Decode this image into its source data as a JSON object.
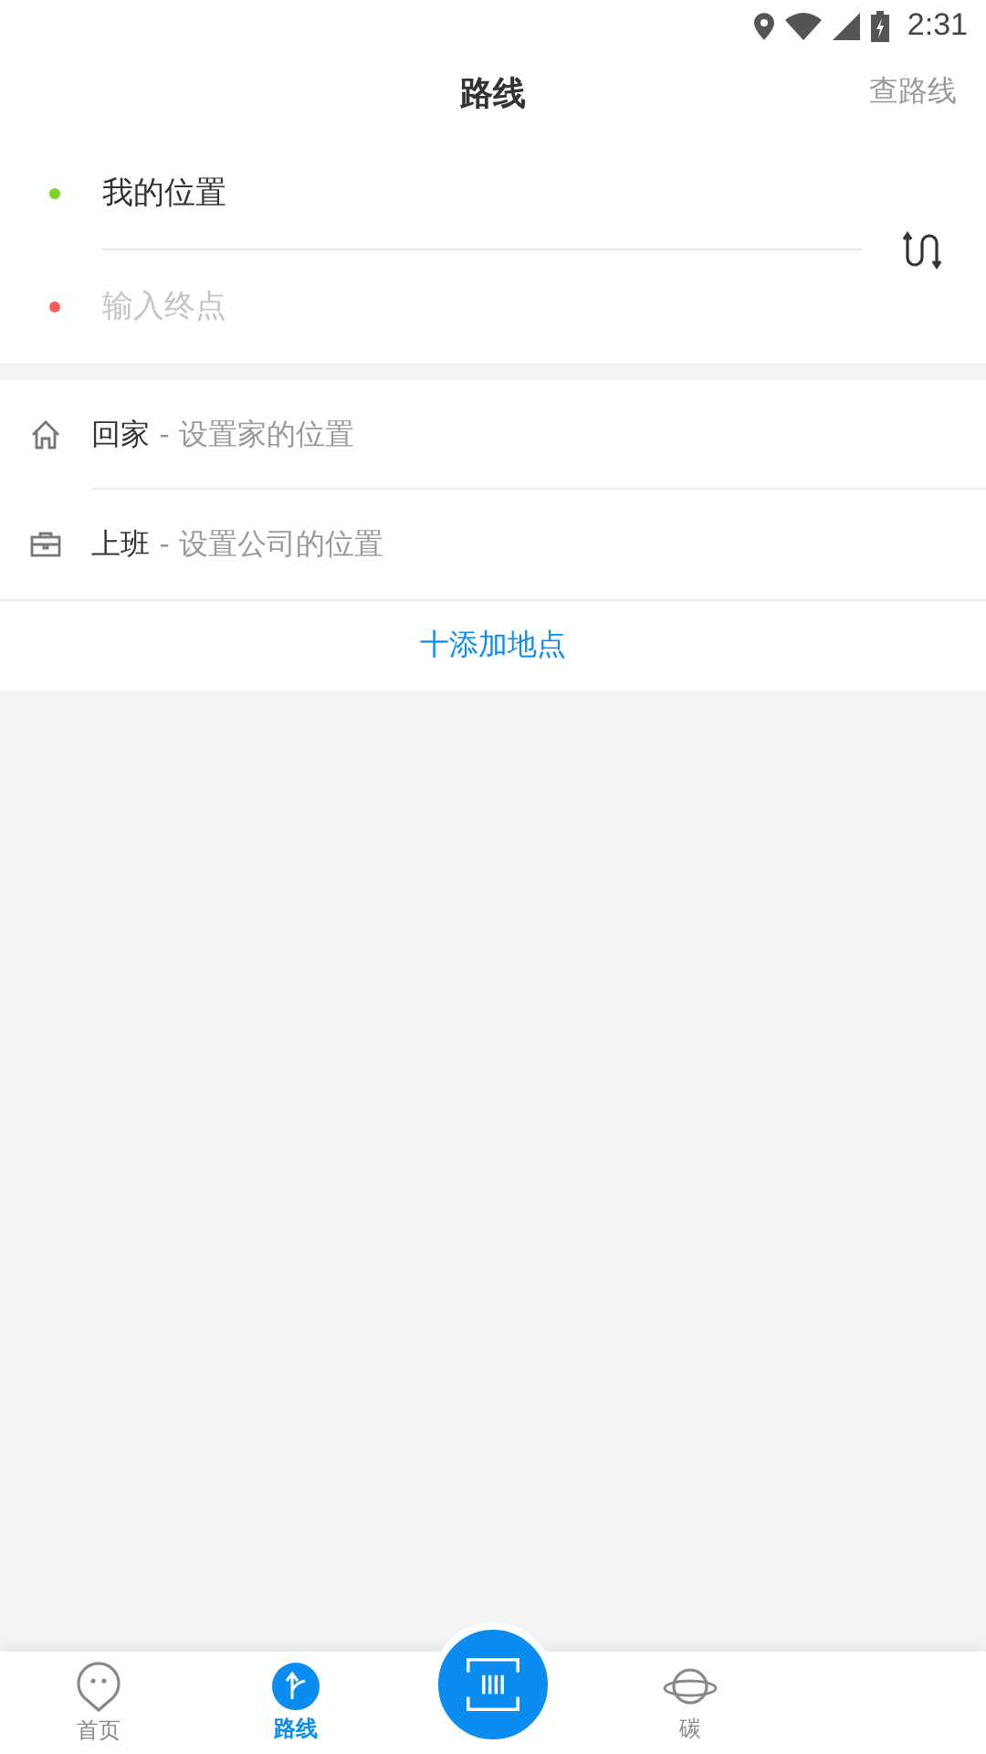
{
  "status_bar": {
    "time": "2:31"
  },
  "header": {
    "title": "路线",
    "action": "查路线"
  },
  "route": {
    "start": {
      "value": "我的位置",
      "color": "#7ed321"
    },
    "end": {
      "placeholder": "输入终点",
      "color": "#ff5a5a"
    }
  },
  "places": [
    {
      "kind": "home",
      "name": "回家",
      "hint": "- 设置家的位置"
    },
    {
      "kind": "work",
      "name": "上班",
      "hint": "- 设置公司的位置"
    }
  ],
  "add_place": "十添加地点",
  "tabs": [
    {
      "kind": "home",
      "label": "首页",
      "selected": false
    },
    {
      "kind": "route",
      "label": "路线",
      "selected": true
    },
    {
      "kind": "scan"
    },
    {
      "kind": "planet",
      "label": "碳",
      "selected": false
    }
  ]
}
